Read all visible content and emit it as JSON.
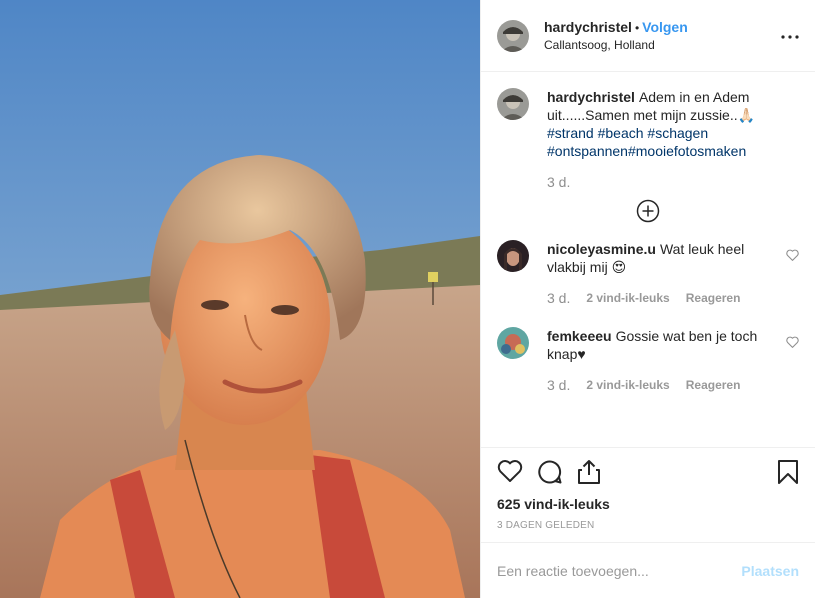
{
  "colors": {
    "accent": "#3897f0",
    "hashtag": "#003569",
    "muted": "#999999",
    "post_disabled": "#b2dffc"
  },
  "header": {
    "username": "hardychristel",
    "separator": "•",
    "follow_label": "Volgen",
    "location": "Callantsoog, Holland",
    "more_icon": "more-dots-icon"
  },
  "caption": {
    "username": "hardychristel",
    "text": "Adem in en Adem uit......Samen met mijn zussie..🙏🏻",
    "hashtags_line1": "#strand #beach #schagen",
    "hashtags_line2": "#ontspannen#mooiefotosmaken",
    "time": "3 d."
  },
  "load_more_icon": "plus-circle-icon",
  "comments": [
    {
      "username": "nicoleyasmine.u",
      "text": "Wat leuk heel vlakbij mij 😍",
      "time": "3 d.",
      "likes": "2 vind-ik-leuks",
      "reply": "Reageren"
    },
    {
      "username": "femkeeeu",
      "text": "Gossie wat ben je toch knap♥",
      "time": "3 d.",
      "likes": "2 vind-ik-leuks",
      "reply": "Reageren"
    }
  ],
  "actions": {
    "like_icon": "heart-icon",
    "comment_icon": "comment-icon",
    "share_icon": "share-icon",
    "save_icon": "bookmark-icon",
    "likes_count": "625 vind-ik-leuks",
    "date": "3 DAGEN GELEDEN"
  },
  "add_comment": {
    "placeholder": "Een reactie toevoegen...",
    "post_label": "Plaatsen"
  }
}
